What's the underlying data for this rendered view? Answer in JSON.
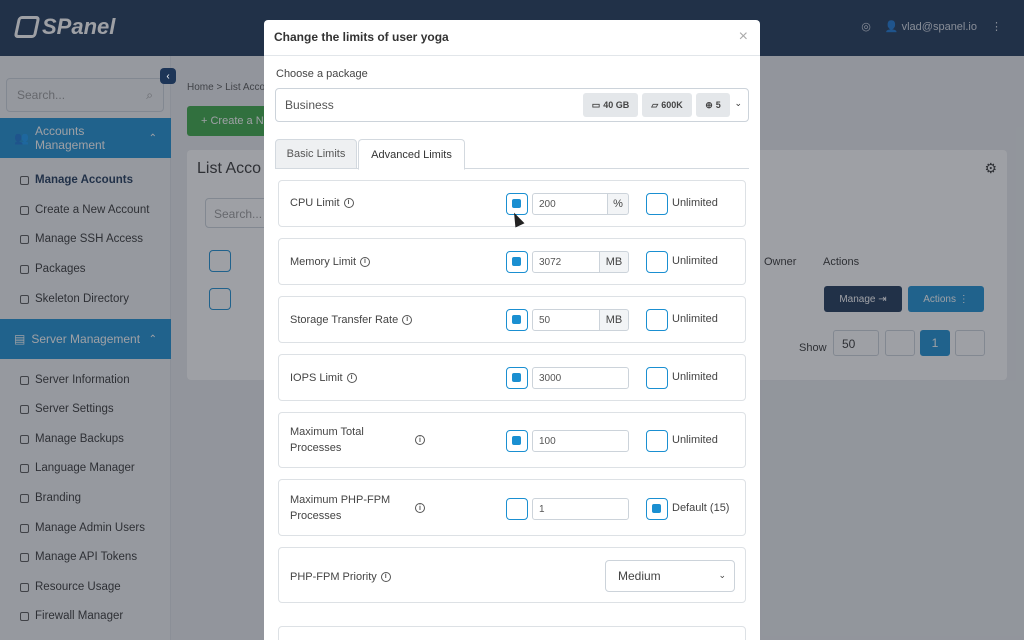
{
  "app": {
    "logo": "SPanel",
    "user_email": "vlad@spanel.io"
  },
  "sidebar": {
    "search_placeholder": "Search...",
    "section1": "Accounts Management",
    "section1_items": [
      "Manage Accounts",
      "Create a New Account",
      "Manage SSH Access",
      "Packages",
      "Skeleton Directory"
    ],
    "section2": "Server Management",
    "section2_items": [
      "Server Information",
      "Server Settings",
      "Manage Backups",
      "Language Manager",
      "Branding",
      "Manage Admin Users",
      "Manage API Tokens",
      "Resource Usage",
      "Firewall Manager"
    ]
  },
  "background": {
    "breadcrumb": "Home  >  List Acco",
    "create_button": "+ Create a N",
    "card_title": "List Acco",
    "search_placeholder": "Search...",
    "col_owner": "Owner",
    "col_actions": "Actions",
    "manage_button": "Manage",
    "actions_button": "Actions",
    "show_label": "Show",
    "show_value": "50",
    "current_page": "1"
  },
  "modal": {
    "title": "Change the limits of user yoga",
    "package_label": "Choose a package",
    "package_name": "Business",
    "badges": {
      "disk": "40 GB",
      "inodes": "600K",
      "domains": "5"
    },
    "tabs": [
      "Basic Limits",
      "Advanced Limits"
    ],
    "unlimited_label": "Unlimited",
    "limits": [
      {
        "label": "CPU Limit",
        "value": "200",
        "unit": "%",
        "checked": true,
        "unlimited": false
      },
      {
        "label": "Memory Limit",
        "value": "3072",
        "unit": "MB",
        "checked": true,
        "unlimited": false
      },
      {
        "label": "Storage Transfer Rate",
        "value": "50",
        "unit": "MB",
        "checked": true,
        "unlimited": false
      },
      {
        "label": "IOPS Limit",
        "value": "3000",
        "unit": "",
        "checked": true,
        "unlimited": false
      },
      {
        "label": "Maximum Total\nProcesses",
        "value": "100",
        "unit": "",
        "checked": true,
        "unlimited": false
      },
      {
        "label": "Maximum PHP-FPM\nProcesses",
        "value": "1",
        "unit": "",
        "checked": false,
        "unlimited": true,
        "right_label": "Default (15)"
      }
    ],
    "priority_label": "PHP-FPM Priority",
    "priority_value": "Medium"
  },
  "colors": {
    "topbar": "#1d3557",
    "accent": "#1a8fd1",
    "green": "#3aa844"
  }
}
